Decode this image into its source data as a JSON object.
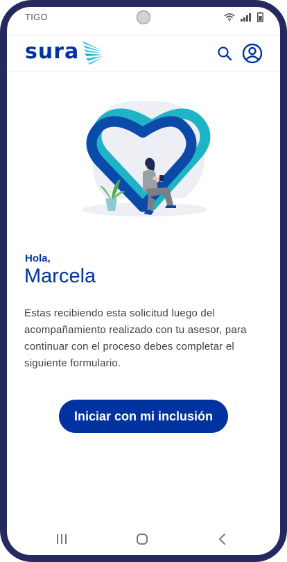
{
  "status_bar": {
    "carrier": "TIGO",
    "icons": [
      "wifi-icon",
      "signal-icon",
      "battery-icon"
    ]
  },
  "header": {
    "logo_text": "sura",
    "icons": [
      "search-icon",
      "user-profile-icon"
    ]
  },
  "content": {
    "greeting": "Hola,",
    "user_name": "Marcela",
    "message": "Estas recibiendo esta solicitud luego del acompañamiento realizado con tu asesor, para continuar con el proceso debes completar el siguiente formulario.",
    "cta_label": "Iniciar con mi inclusión"
  },
  "nav_bar": {
    "icons": [
      "recent-apps-icon",
      "home-icon",
      "back-icon"
    ]
  },
  "colors": {
    "brand_blue": "#0033a0",
    "accent_teal": "#1fb3c8",
    "frame": "#242a5f"
  }
}
